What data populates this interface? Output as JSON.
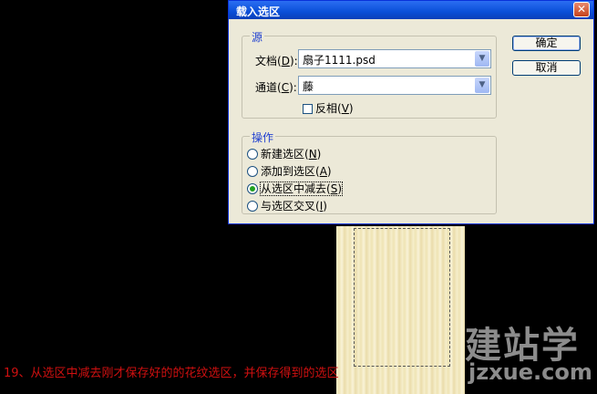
{
  "dialog": {
    "title": "载入选区",
    "close_glyph": "✕",
    "source_group": {
      "label": "源",
      "document_label_pre": "文档(",
      "document_label_key": "D",
      "document_label_post": "):",
      "document_value": "扇子1111.psd",
      "channel_label_pre": "通道(",
      "channel_label_key": "C",
      "channel_label_post": "):",
      "channel_value": "藤",
      "invert_pre": "反相(",
      "invert_key": "V",
      "invert_post": ")",
      "invert_checked": false
    },
    "operation_group": {
      "label": "操作",
      "options": [
        {
          "pre": "新建选区(",
          "key": "N",
          "post": ")",
          "selected": false
        },
        {
          "pre": "添加到选区(",
          "key": "A",
          "post": ")",
          "selected": false
        },
        {
          "pre": "从选区中减去(",
          "key": "S",
          "post": ")",
          "selected": true
        },
        {
          "pre": "与选区交叉(",
          "key": "I",
          "post": ")",
          "selected": false
        }
      ]
    },
    "buttons": {
      "ok": "确定",
      "cancel": "取消"
    }
  },
  "caption": "19、从选区中减去刚才保存好的的花纹选区，并保存得到的选区",
  "watermark": {
    "line1": "建站学",
    "line2": "jzxue.com"
  },
  "colors": {
    "title_bar": "#0a4fd8",
    "dialog_bg": "#ece9d8",
    "caption": "#d01010",
    "group_label": "#1f3fd0"
  }
}
